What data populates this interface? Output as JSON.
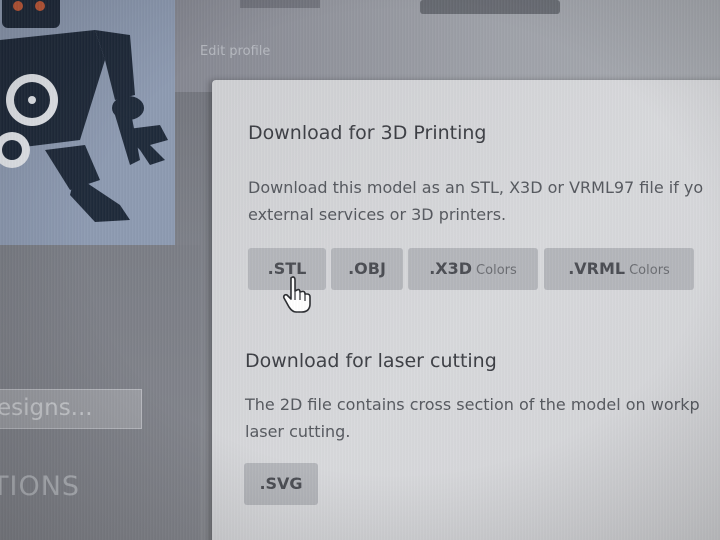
{
  "header": {
    "edit_profile_link": "Edit profile"
  },
  "sidebar": {
    "search_placeholder": "esigns...",
    "collections_heading": "TIONS"
  },
  "modal": {
    "print_section": {
      "heading": "Download for 3D Printing",
      "description_line1": "Download this model as an STL, X3D or VRML97 file if yo",
      "description_line2": "external services or 3D printers.",
      "buttons": [
        {
          "label": ".STL",
          "sub": ""
        },
        {
          "label": ".OBJ",
          "sub": ""
        },
        {
          "label": ".X3D",
          "sub": "Colors"
        },
        {
          "label": ".VRML",
          "sub": "Colors"
        }
      ]
    },
    "laser_section": {
      "heading": "Download for laser cutting",
      "description_line1": "The 2D file contains cross section of the model on workp",
      "description_line2": "laser cutting.",
      "buttons": [
        {
          "label": ".SVG"
        }
      ]
    }
  },
  "icons": {
    "avatar": "robot-avatar-icon",
    "cursor": "hand-pointer-icon"
  },
  "colors": {
    "modal_background": "#d4d5d8",
    "button_background": "#b4b6bb",
    "avatar_background": "#8d9ab1",
    "robot_dark": "#1f2a3a"
  }
}
